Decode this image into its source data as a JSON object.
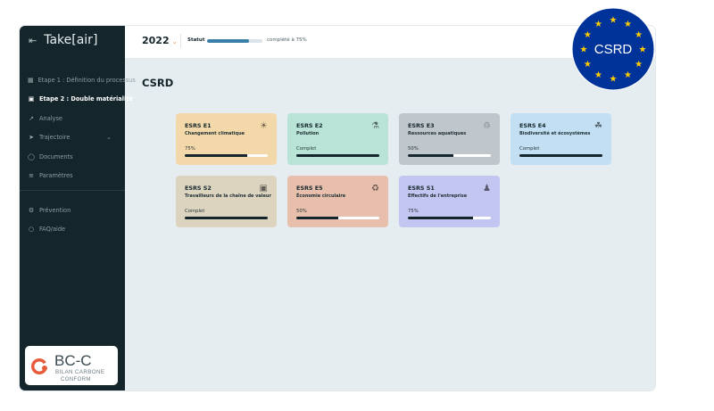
{
  "app": {
    "logo": "Take[air]",
    "collapse_icon": "arrow-left-to-bar-icon"
  },
  "sidebar": {
    "items": [
      {
        "label": "Etape 1 : Définition du processus",
        "icon": "grid-icon",
        "active": false
      },
      {
        "label": "Etape 2 : Double matérialité",
        "icon": "square-icon",
        "active": true
      },
      {
        "label": "Analyse",
        "icon": "chart-line-icon",
        "active": false
      },
      {
        "label": "Trajectoire",
        "icon": "rocket-icon",
        "active": false,
        "expandable": true
      },
      {
        "label": "Documents",
        "icon": "folder-icon",
        "active": false
      },
      {
        "label": "Paramètres",
        "icon": "sliders-icon",
        "active": false
      }
    ],
    "bottom_items": [
      {
        "label": "Prévention",
        "icon": "gear-person-icon"
      },
      {
        "label": "FAQ/aide",
        "icon": "chat-icon"
      }
    ]
  },
  "badge_bcc": {
    "title": "BC-C",
    "line1": "BILAN CARBONE",
    "line2": "CONFORM"
  },
  "badge_eu": {
    "label": "CSRD",
    "star_color": "#ffcc00",
    "bg_color": "#003399"
  },
  "topbar": {
    "year": "2022",
    "statut_label": "Statut",
    "progress": 0.75,
    "progress_text": "complété à 75%"
  },
  "page": {
    "title": "CSRD"
  },
  "cards": [
    {
      "code": "ESRS E1",
      "name": "Changement climatique",
      "status": "75%",
      "progress": 0.75,
      "bg": "#f3d9a9",
      "icon": "fire-icon"
    },
    {
      "code": "ESRS E2",
      "name": "Pollution",
      "status": "Complet",
      "progress": 1.0,
      "bg": "#b8e3d6",
      "icon": "flask-icon"
    },
    {
      "code": "ESRS E3",
      "name": "Ressources aquatiques",
      "status": "50%",
      "progress": 0.55,
      "bg": "#bfc6cc",
      "icon": "trash-icon"
    },
    {
      "code": "ESRS E4",
      "name": "Biodiversité et écosystèmes",
      "status": "Complet",
      "progress": 1.0,
      "bg": "#c2dff4",
      "icon": "leaf-icon"
    },
    {
      "code": "ESRS S2",
      "name": "Travailleurs de la chaîne de valeur",
      "status": "Complet",
      "progress": 1.0,
      "bg": "#ddd4c0",
      "icon": "box-icon"
    },
    {
      "code": "ESRS E5",
      "name": "Économie circulaire",
      "status": "50%",
      "progress": 0.5,
      "bg": "#e7bfac",
      "icon": "recycle-icon"
    },
    {
      "code": "ESRS S1",
      "name": "Effectifs de l'entreprise",
      "status": "75%",
      "progress": 0.78,
      "bg": "#c2c6f0",
      "icon": "people-icon"
    }
  ]
}
